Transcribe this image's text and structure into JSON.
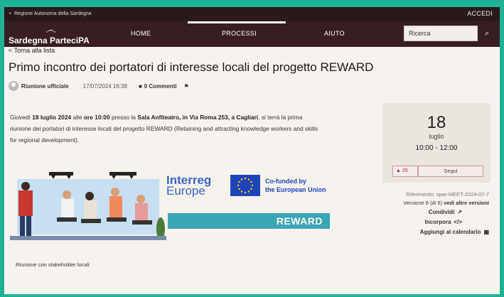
{
  "topbar": {
    "region": "Regione Autonoma della Sardegna",
    "login": "ACCEDI"
  },
  "navbar": {
    "brand": "Sardegna ParteciPA",
    "items": [
      {
        "label": "HOME"
      },
      {
        "label": "PROCESSI"
      },
      {
        "label": "AIUTO"
      }
    ],
    "active_index": 1,
    "search": {
      "value": "Ricerca",
      "button_icon": "search-icon"
    }
  },
  "back_link": "< Torna alla lista",
  "meeting": {
    "title": "Primo incontro dei portatori di interesse locali del progetto REWARD",
    "author": "Riunione ufficiale",
    "datetime": "17/07/2024 16:38",
    "comments": "0 Commenti",
    "description_parts": {
      "p1": "Giovedì ",
      "date_bold": "18 luglio 2024",
      "p2": " alle ",
      "time_bold": "ore 10:00",
      "p3": " presso la ",
      "place_bold": "Sala Anfiteatro, in Via Roma 253, a Cagliari",
      "p4": ", si terrà la prima riunione dei portatori di interesse locali del progetto REWARD (Retaining and attracting knowledge workers and skills for regional development)."
    },
    "image_caption": "Riunione con stakeholder locali"
  },
  "banner": {
    "program_line1": "Interreg",
    "program_line2": "Europe",
    "cofunded_line1": "Co-funded by",
    "cofunded_line2": "the European Union",
    "project": "REWARD"
  },
  "event_card": {
    "day": "18",
    "month": "luglio",
    "time": "10:00 - 12:00",
    "followers": "25",
    "follow_label": "Segui"
  },
  "sidebar": {
    "reference": "Riferimento: spar-MEET-2024-07-7",
    "version_prefix": "Versione 6 ",
    "version_of": "(di 6)",
    "version_link": " vedi altre versioni",
    "share": "Condividi",
    "embed": "Incorpora",
    "calendar": "Aggiungi al calendario"
  },
  "colors": {
    "header": "#361e23",
    "topbar": "#2a1a1c",
    "page": "#f6f2ee",
    "frame": "#1fb394",
    "accent": "#3aa5b5"
  }
}
